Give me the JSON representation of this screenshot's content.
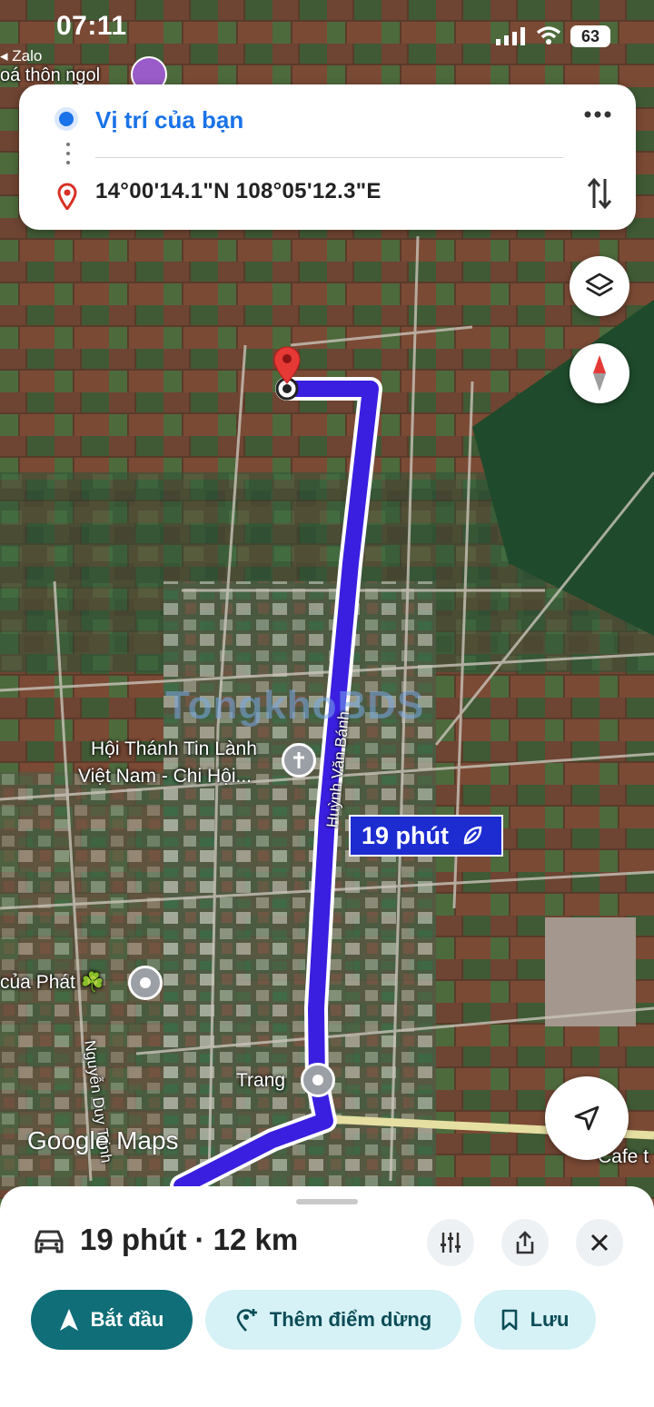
{
  "status_bar": {
    "time": "07:11",
    "back_app": "◂ Zalo",
    "battery": "63"
  },
  "map": {
    "top_place_label": "oá thôn ngol",
    "watermark": "TongkhoBDS",
    "church_label_line1": "Hội Thánh Tin Lành",
    "church_label_line2": "Việt Nam - Chi Hội...",
    "road_label_main": "Huỳnh Văn Bánh",
    "road_label_left": "Nguyễn Duy Trinh",
    "poi_phat": "của Phát",
    "poi_phat_emoji": "☘️",
    "poi_trang": "Trang",
    "poi_cafe": "Cafe t",
    "eta_badge": "19 phút",
    "google_maps": "Google Maps"
  },
  "directions": {
    "origin": "Vị trí của bạn",
    "destination": "14°00'14.1\"N 108°05'12.3\"E"
  },
  "colors": {
    "route": "#3a1fe0",
    "accent": "#1a73e8",
    "start_button": "#0f6e78"
  },
  "sheet": {
    "summary": "19 phút · 12 km",
    "start_label": "Bắt đầu",
    "add_stop_label": "Thêm điểm dừng",
    "save_label": "Lưu"
  },
  "icons": [
    "layers-icon",
    "compass-icon",
    "my-location-icon",
    "car-icon",
    "options-icon",
    "share-icon",
    "close-icon",
    "more-icon",
    "swap-icon",
    "eco-leaf-icon"
  ]
}
